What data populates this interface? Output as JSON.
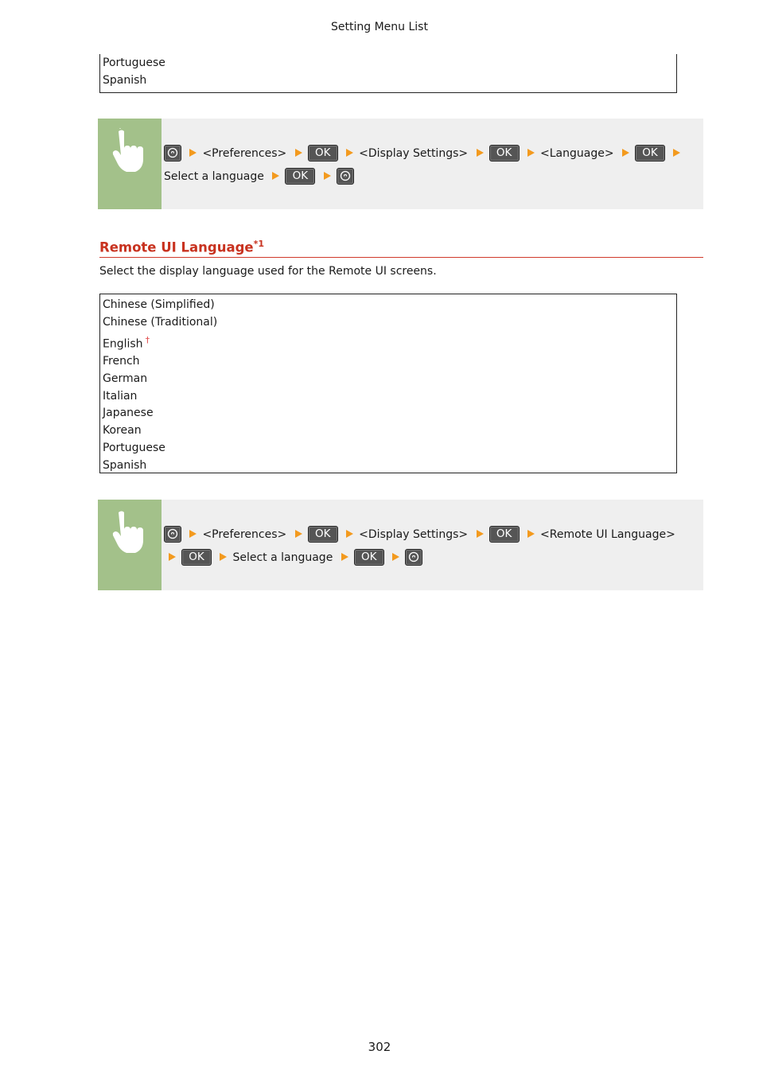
{
  "header": {
    "title": "Setting Menu List"
  },
  "top_list": {
    "items": [
      "Portuguese",
      "Spanish"
    ]
  },
  "procedure1": {
    "steps": [
      {
        "type": "home"
      },
      {
        "type": "arrow"
      },
      {
        "type": "text",
        "text": "<Preferences>"
      },
      {
        "type": "arrow"
      },
      {
        "type": "ok",
        "text": "OK"
      },
      {
        "type": "arrow"
      },
      {
        "type": "text",
        "text": "<Display Settings>"
      },
      {
        "type": "arrow"
      },
      {
        "type": "ok",
        "text": "OK"
      },
      {
        "type": "arrow"
      },
      {
        "type": "text",
        "text": "<Language>"
      },
      {
        "type": "arrow"
      },
      {
        "type": "ok",
        "text": "OK"
      },
      {
        "type": "arrow"
      },
      {
        "type": "text",
        "text": "Select a language"
      },
      {
        "type": "arrow"
      },
      {
        "type": "ok",
        "text": "OK"
      },
      {
        "type": "arrow"
      },
      {
        "type": "home"
      }
    ]
  },
  "section": {
    "title": "Remote UI Language",
    "title_footnote": "*1",
    "description": "Select the display language used for the Remote UI screens.",
    "options": [
      {
        "label": "Chinese (Simplified)"
      },
      {
        "label": "Chinese (Traditional)"
      },
      {
        "label": "English",
        "default_marker": "†"
      },
      {
        "label": "French"
      },
      {
        "label": "German"
      },
      {
        "label": "Italian"
      },
      {
        "label": "Japanese"
      },
      {
        "label": "Korean"
      },
      {
        "label": "Portuguese"
      },
      {
        "label": "Spanish"
      }
    ]
  },
  "procedure2": {
    "steps": [
      {
        "type": "home"
      },
      {
        "type": "arrow"
      },
      {
        "type": "text",
        "text": "<Preferences>"
      },
      {
        "type": "arrow"
      },
      {
        "type": "ok",
        "text": "OK"
      },
      {
        "type": "arrow"
      },
      {
        "type": "text",
        "text": "<Display Settings>"
      },
      {
        "type": "arrow"
      },
      {
        "type": "ok",
        "text": "OK"
      },
      {
        "type": "arrow"
      },
      {
        "type": "text",
        "text": "<Remote UI Language>"
      },
      {
        "type": "arrow"
      },
      {
        "type": "ok",
        "text": "OK"
      },
      {
        "type": "arrow"
      },
      {
        "type": "text",
        "text": "Select a language"
      },
      {
        "type": "arrow"
      },
      {
        "type": "ok",
        "text": "OK"
      },
      {
        "type": "arrow"
      },
      {
        "type": "home"
      }
    ]
  },
  "footer": {
    "page_number": "302"
  },
  "colors": {
    "accent_red": "#c8321f",
    "arrow_orange": "#f39a1e",
    "hand_green": "#a3c18a",
    "panel_gray": "#efefef"
  }
}
